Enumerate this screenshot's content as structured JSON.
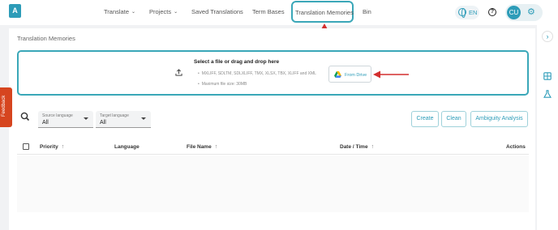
{
  "nav": {
    "logo": "A",
    "items": [
      {
        "label": "Translate",
        "has_dropdown": true
      },
      {
        "label": "Projects",
        "has_dropdown": true
      },
      {
        "label": "Saved Translations",
        "has_dropdown": false
      },
      {
        "label": "Term Bases",
        "has_dropdown": false
      },
      {
        "label": "Translation Memories",
        "has_dropdown": false,
        "active": true
      },
      {
        "label": "Bin",
        "has_dropdown": false
      }
    ],
    "language": "EN",
    "help_icon": "?",
    "avatar_initials": "CU",
    "settings_icon": "gear-icon"
  },
  "page": {
    "title": "Translation Memories"
  },
  "dropzone": {
    "title": "Select a file or drag and drop here",
    "formats": "MXLIFF, SDLTM, SDLXLIFF, TMX, XLSX, TBX, XLIFF and XML",
    "max_size": "Maximum file size: 30MB",
    "drive_button": "From Drive"
  },
  "filters": {
    "source": {
      "label": "Source language",
      "value": "All"
    },
    "target": {
      "label": "Target language",
      "value": "All"
    }
  },
  "actions": {
    "create": "Create",
    "clean": "Clean",
    "ambiguity": "Ambiguity Analysis"
  },
  "table": {
    "columns": [
      {
        "label": "Priority",
        "sortable": true
      },
      {
        "label": "Language",
        "sortable": false
      },
      {
        "label": "File Name",
        "sortable": true
      },
      {
        "label": "Date / Time",
        "sortable": true
      },
      {
        "label": "Actions",
        "sortable": false
      }
    ],
    "rows": []
  },
  "feedback": "Feedback",
  "colors": {
    "accent": "#2d9cb8",
    "annotation": "#d32f2f",
    "feedback": "#d6451f"
  }
}
